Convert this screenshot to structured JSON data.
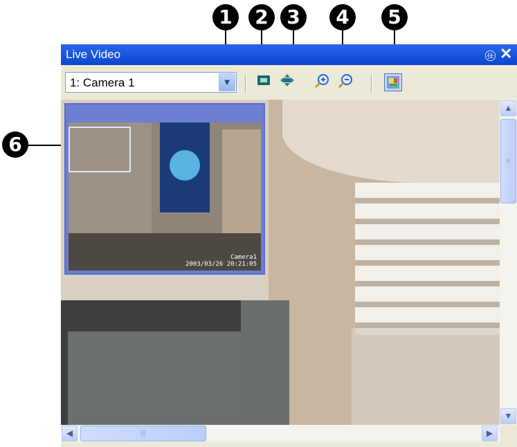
{
  "callouts": [
    "1",
    "2",
    "3",
    "4",
    "5",
    "6"
  ],
  "window": {
    "title": "Live Video",
    "pin_icon": "pin-icon",
    "close_icon": "close-icon"
  },
  "toolbar": {
    "camera_select_value": "1: Camera 1",
    "buttons": [
      {
        "name": "fit-to-window",
        "icon": "fit-window-icon"
      },
      {
        "name": "pan",
        "icon": "pan-arrows-icon"
      },
      {
        "name": "zoom-in",
        "icon": "zoom-in-icon"
      },
      {
        "name": "zoom-out",
        "icon": "zoom-out-icon"
      },
      {
        "name": "thumbnail-view",
        "icon": "thumbnail-view-icon",
        "active": true
      }
    ]
  },
  "video": {
    "thumbnail_caption_line1": "Camera1",
    "thumbnail_caption_line2": "2003/03/26 20:21:05"
  },
  "colors": {
    "title_bar": "#0846cf",
    "toolbar_bg": "#ece9d8",
    "thumbnail_border": "#5a6cc8"
  }
}
